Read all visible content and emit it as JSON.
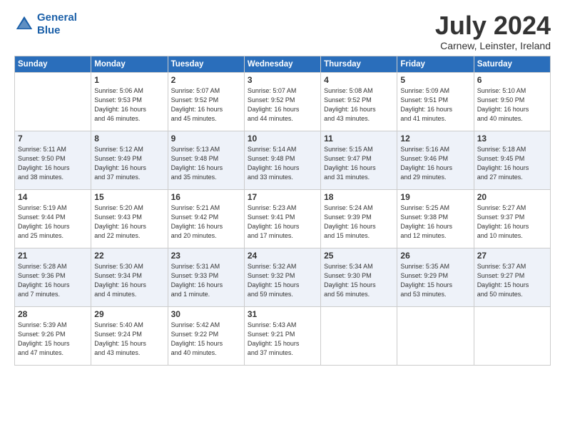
{
  "logo": {
    "line1": "General",
    "line2": "Blue"
  },
  "title": "July 2024",
  "subtitle": "Carnew, Leinster, Ireland",
  "headers": [
    "Sunday",
    "Monday",
    "Tuesday",
    "Wednesday",
    "Thursday",
    "Friday",
    "Saturday"
  ],
  "weeks": [
    [
      {
        "day": "",
        "info": ""
      },
      {
        "day": "1",
        "info": "Sunrise: 5:06 AM\nSunset: 9:53 PM\nDaylight: 16 hours\nand 46 minutes."
      },
      {
        "day": "2",
        "info": "Sunrise: 5:07 AM\nSunset: 9:52 PM\nDaylight: 16 hours\nand 45 minutes."
      },
      {
        "day": "3",
        "info": "Sunrise: 5:07 AM\nSunset: 9:52 PM\nDaylight: 16 hours\nand 44 minutes."
      },
      {
        "day": "4",
        "info": "Sunrise: 5:08 AM\nSunset: 9:52 PM\nDaylight: 16 hours\nand 43 minutes."
      },
      {
        "day": "5",
        "info": "Sunrise: 5:09 AM\nSunset: 9:51 PM\nDaylight: 16 hours\nand 41 minutes."
      },
      {
        "day": "6",
        "info": "Sunrise: 5:10 AM\nSunset: 9:50 PM\nDaylight: 16 hours\nand 40 minutes."
      }
    ],
    [
      {
        "day": "7",
        "info": "Sunrise: 5:11 AM\nSunset: 9:50 PM\nDaylight: 16 hours\nand 38 minutes."
      },
      {
        "day": "8",
        "info": "Sunrise: 5:12 AM\nSunset: 9:49 PM\nDaylight: 16 hours\nand 37 minutes."
      },
      {
        "day": "9",
        "info": "Sunrise: 5:13 AM\nSunset: 9:48 PM\nDaylight: 16 hours\nand 35 minutes."
      },
      {
        "day": "10",
        "info": "Sunrise: 5:14 AM\nSunset: 9:48 PM\nDaylight: 16 hours\nand 33 minutes."
      },
      {
        "day": "11",
        "info": "Sunrise: 5:15 AM\nSunset: 9:47 PM\nDaylight: 16 hours\nand 31 minutes."
      },
      {
        "day": "12",
        "info": "Sunrise: 5:16 AM\nSunset: 9:46 PM\nDaylight: 16 hours\nand 29 minutes."
      },
      {
        "day": "13",
        "info": "Sunrise: 5:18 AM\nSunset: 9:45 PM\nDaylight: 16 hours\nand 27 minutes."
      }
    ],
    [
      {
        "day": "14",
        "info": "Sunrise: 5:19 AM\nSunset: 9:44 PM\nDaylight: 16 hours\nand 25 minutes."
      },
      {
        "day": "15",
        "info": "Sunrise: 5:20 AM\nSunset: 9:43 PM\nDaylight: 16 hours\nand 22 minutes."
      },
      {
        "day": "16",
        "info": "Sunrise: 5:21 AM\nSunset: 9:42 PM\nDaylight: 16 hours\nand 20 minutes."
      },
      {
        "day": "17",
        "info": "Sunrise: 5:23 AM\nSunset: 9:41 PM\nDaylight: 16 hours\nand 17 minutes."
      },
      {
        "day": "18",
        "info": "Sunrise: 5:24 AM\nSunset: 9:39 PM\nDaylight: 16 hours\nand 15 minutes."
      },
      {
        "day": "19",
        "info": "Sunrise: 5:25 AM\nSunset: 9:38 PM\nDaylight: 16 hours\nand 12 minutes."
      },
      {
        "day": "20",
        "info": "Sunrise: 5:27 AM\nSunset: 9:37 PM\nDaylight: 16 hours\nand 10 minutes."
      }
    ],
    [
      {
        "day": "21",
        "info": "Sunrise: 5:28 AM\nSunset: 9:36 PM\nDaylight: 16 hours\nand 7 minutes."
      },
      {
        "day": "22",
        "info": "Sunrise: 5:30 AM\nSunset: 9:34 PM\nDaylight: 16 hours\nand 4 minutes."
      },
      {
        "day": "23",
        "info": "Sunrise: 5:31 AM\nSunset: 9:33 PM\nDaylight: 16 hours\nand 1 minute."
      },
      {
        "day": "24",
        "info": "Sunrise: 5:32 AM\nSunset: 9:32 PM\nDaylight: 15 hours\nand 59 minutes."
      },
      {
        "day": "25",
        "info": "Sunrise: 5:34 AM\nSunset: 9:30 PM\nDaylight: 15 hours\nand 56 minutes."
      },
      {
        "day": "26",
        "info": "Sunrise: 5:35 AM\nSunset: 9:29 PM\nDaylight: 15 hours\nand 53 minutes."
      },
      {
        "day": "27",
        "info": "Sunrise: 5:37 AM\nSunset: 9:27 PM\nDaylight: 15 hours\nand 50 minutes."
      }
    ],
    [
      {
        "day": "28",
        "info": "Sunrise: 5:39 AM\nSunset: 9:26 PM\nDaylight: 15 hours\nand 47 minutes."
      },
      {
        "day": "29",
        "info": "Sunrise: 5:40 AM\nSunset: 9:24 PM\nDaylight: 15 hours\nand 43 minutes."
      },
      {
        "day": "30",
        "info": "Sunrise: 5:42 AM\nSunset: 9:22 PM\nDaylight: 15 hours\nand 40 minutes."
      },
      {
        "day": "31",
        "info": "Sunrise: 5:43 AM\nSunset: 9:21 PM\nDaylight: 15 hours\nand 37 minutes."
      },
      {
        "day": "",
        "info": ""
      },
      {
        "day": "",
        "info": ""
      },
      {
        "day": "",
        "info": ""
      }
    ]
  ]
}
